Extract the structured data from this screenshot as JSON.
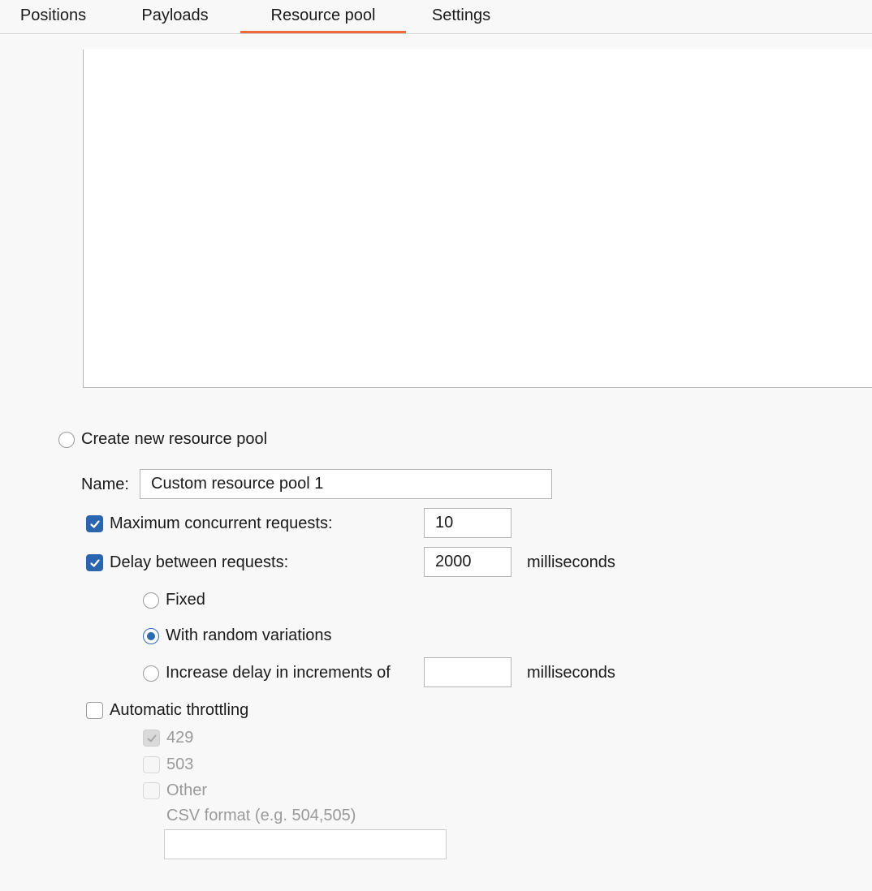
{
  "tabs": [
    {
      "label": "Positions",
      "active": false
    },
    {
      "label": "Payloads",
      "active": false
    },
    {
      "label": "Resource pool",
      "active": true
    },
    {
      "label": "Settings",
      "active": false
    }
  ],
  "accent_color": "#ee6b3b",
  "check_color": "#2a65ad",
  "create_pool": {
    "label": "Create new resource pool",
    "selected": false
  },
  "name": {
    "label": "Name:",
    "value": "Custom resource pool 1"
  },
  "max_concurrent": {
    "label": "Maximum concurrent requests:",
    "checked": true,
    "value": "10"
  },
  "delay": {
    "label": "Delay between requests:",
    "checked": true,
    "value": "2000",
    "unit": "milliseconds"
  },
  "delay_modes": {
    "fixed": {
      "label": "Fixed",
      "selected": false
    },
    "random": {
      "label": "With random variations",
      "selected": true
    },
    "increase": {
      "label": "Increase delay in increments of",
      "selected": false,
      "value": "",
      "unit": "milliseconds"
    }
  },
  "throttling": {
    "label": "Automatic throttling",
    "checked": false,
    "codes": [
      {
        "label": "429",
        "checked": true
      },
      {
        "label": "503",
        "checked": false
      },
      {
        "label": "Other",
        "checked": false
      }
    ],
    "csv_label": "CSV format (e.g. 504,505)",
    "csv_value": ""
  },
  "icons": {
    "check": "checkmark-icon",
    "radio": "radio-dot-icon"
  }
}
